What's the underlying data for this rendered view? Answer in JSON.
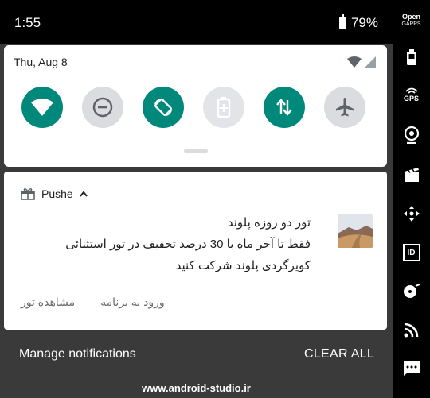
{
  "status_bar": {
    "time": "1:55",
    "battery_percent": "79%"
  },
  "quick_settings": {
    "date": "Thu, Aug 8",
    "tiles": [
      {
        "icon": "wifi-icon",
        "state": "on"
      },
      {
        "icon": "do-not-disturb-icon",
        "state": "off"
      },
      {
        "icon": "auto-rotate-icon",
        "state": "on"
      },
      {
        "icon": "battery-saver-icon",
        "state": "disabled"
      },
      {
        "icon": "mobile-data-icon",
        "state": "on"
      },
      {
        "icon": "airplane-mode-icon",
        "state": "off"
      }
    ]
  },
  "notification": {
    "app_name": "Pushe",
    "title": "تور دو روزه پلوند",
    "body": "فقط تا آخر ماه با 30 درصد تخفیف در تور استثنائی کویرگردی پلوند شرکت کنید",
    "actions": [
      "ورود به برنامه",
      "مشاهده تور"
    ]
  },
  "footer": {
    "manage_label": "Manage notifications",
    "clear_label": "CLEAR ALL"
  },
  "watermark": "www.android-studio.ir",
  "sidebar": {
    "open_gapps_line1": "Open",
    "open_gapps_line2": "GAPPS",
    "gps_label": "GPS",
    "id_label": "ID",
    "items": [
      "opengapps-icon",
      "battery-icon",
      "gps-icon",
      "webcam-icon",
      "clapperboard-icon",
      "move-icon",
      "id-icon",
      "disc-icon",
      "rss-icon",
      "message-icon"
    ]
  },
  "colors": {
    "accent": "#00897b",
    "panel": "#ffffff",
    "shade": "#3a3a3a"
  }
}
